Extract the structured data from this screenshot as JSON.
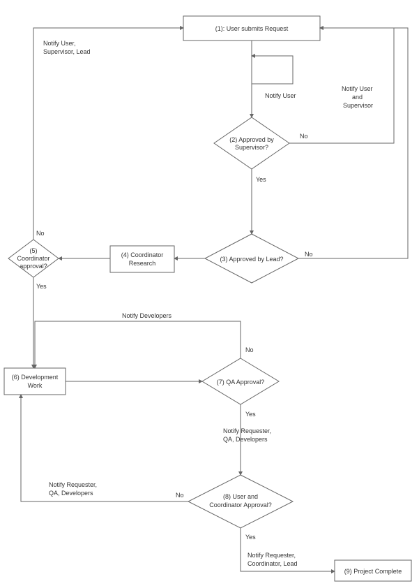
{
  "nodes": {
    "n1": "(1): User submits Request",
    "n2a": "(2) Approved by",
    "n2b": "Supervisor?",
    "n3": "(3) Approved by Lead?",
    "n4a": "(4) Coordinator",
    "n4b": "Research",
    "n5a": "(5)",
    "n5b": "Coordinator",
    "n5c": "approval?",
    "n6a": "(6) Development",
    "n6b": "Work",
    "n7": "(7) QA Approval?",
    "n8a": "(8) User and",
    "n8b": "Coordinator Approval?",
    "n9": "(9) Project Complete"
  },
  "labels": {
    "yes": "Yes",
    "no": "No",
    "notify_user": "Notify User",
    "notify_user_supervisor": "Notify User\nand\nSupervisor",
    "notify_user_sup_lead": "Notify User,\nSupervisor, Lead",
    "notify_developers": "Notify Developers",
    "notify_req_qa_dev": "Notify Requester,\nQA, Developers",
    "notify_req_coord_lead": "Notify Requester,\nCoordinator, Lead"
  }
}
